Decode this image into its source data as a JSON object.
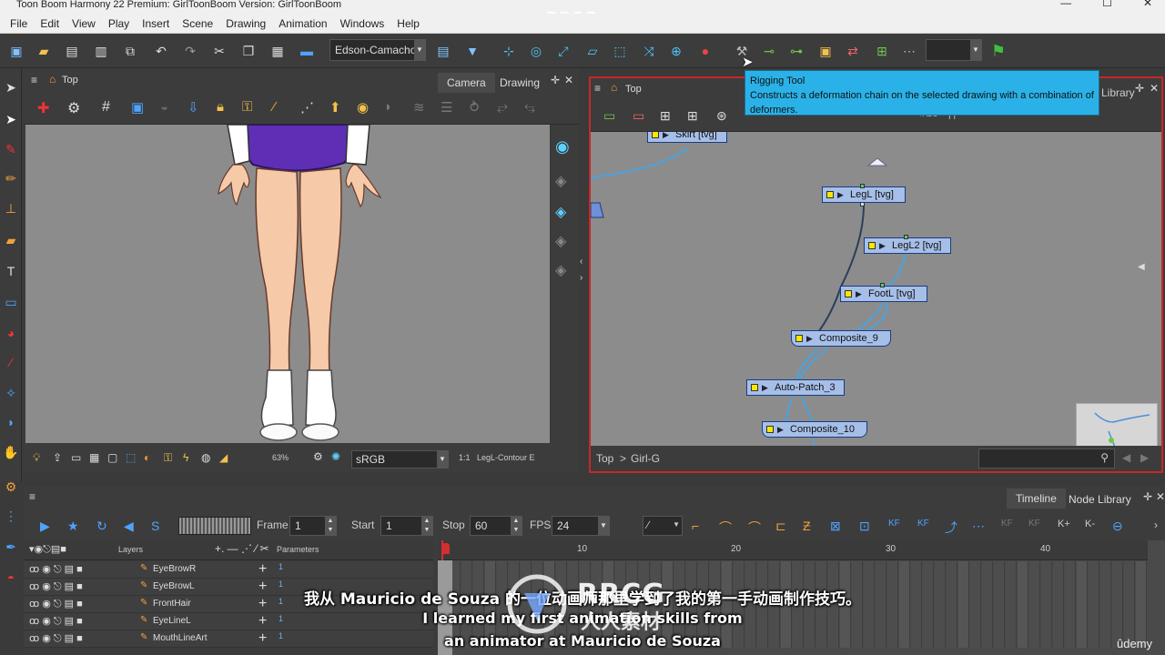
{
  "app": {
    "title": "Toon Boom Harmony 22 Premium: GirlToonBoom Version: GirlToonBoom",
    "watermark": "RRCG.cn"
  },
  "menu": [
    "File",
    "Edit",
    "View",
    "Play",
    "Insert",
    "Scene",
    "Drawing",
    "Animation",
    "Windows",
    "Help"
  ],
  "toolbar": {
    "user_select": "Edson-Camacho"
  },
  "camera_view": {
    "breadcrumb": "Top",
    "tabs": [
      "Camera",
      "Drawing"
    ],
    "active_tab": "Camera",
    "zoom": "63%",
    "color_space": "sRGB",
    "ratio": "1:1",
    "current_drawing": "LegL-Contour E"
  },
  "node_view": {
    "breadcrumb": "Top",
    "tab_partial": "Library",
    "path": [
      "Top",
      "Girl-G"
    ],
    "nodes": [
      {
        "label": "Skirt  [tvg]",
        "kind": "drawing"
      },
      {
        "label": "LegL  [tvg]",
        "kind": "drawing"
      },
      {
        "label": "LegL2  [tvg]",
        "kind": "drawing"
      },
      {
        "label": "FootL  [tvg]",
        "kind": "drawing"
      },
      {
        "label": "Composite_9",
        "kind": "composite"
      },
      {
        "label": "Auto-Patch_3",
        "kind": "patch"
      },
      {
        "label": "Composite_10",
        "kind": "composite"
      }
    ]
  },
  "tooltip": {
    "title": "Rigging Tool",
    "body": "Constructs a deformation chain on the selected drawing with a combination of deformers."
  },
  "timeline": {
    "tabs": [
      "Timeline",
      "Node Library"
    ],
    "active_tab": "Timeline",
    "frame_label": "Frame",
    "frame_value": "1",
    "start_label": "Start",
    "start_value": "1",
    "stop_label": "Stop",
    "stop_value": "60",
    "fps_label": "FPS",
    "fps_value": "24",
    "layers_header": "Layers",
    "parameters_header": "Parameters",
    "layers": [
      "EyeBrowR",
      "EyeBrowL",
      "FrontHair",
      "EyeLineL",
      "MouthLineArt"
    ],
    "ruler_ticks": [
      "10",
      "20",
      "30",
      "40"
    ]
  },
  "subtitles": {
    "zh": "我从 Mauricio de Souza 的一位动画师那里学到了我的第一手动画制作技巧。",
    "en_line1": "I learned my first animation skills from",
    "en_line2": "an animator at Mauricio de Souza"
  },
  "branding": {
    "udemy": "ûdemy",
    "rrcg": "RRCG",
    "rrcg_cn": "人人素材"
  }
}
